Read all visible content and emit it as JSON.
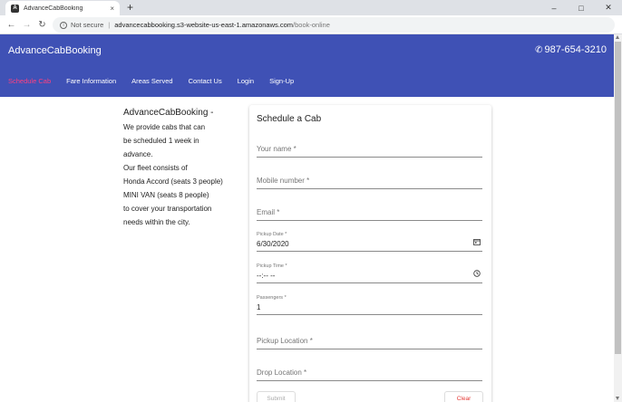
{
  "browser": {
    "tab_title": "AdvanceCabBooking",
    "tab_close": "×",
    "new_tab": "+",
    "security": "Not secure",
    "url_host": "advancecabbooking.s3-website-us-east-1.amazonaws.com",
    "url_path": "/book-online",
    "minimize": "–",
    "maximize": "□",
    "close": "✕"
  },
  "header": {
    "brand": "AdvanceCabBooking",
    "phone": "987-654-3210"
  },
  "nav": [
    {
      "label": "Schedule Cab",
      "active": true
    },
    {
      "label": "Fare Information"
    },
    {
      "label": "Areas Served"
    },
    {
      "label": "Contact Us"
    },
    {
      "label": "Login"
    },
    {
      "label": "Sign-Up"
    }
  ],
  "about": {
    "title": "AdvanceCabBooking -",
    "lines": [
      "We provide cabs that can",
      "be scheduled 1 week in",
      "advance.",
      "Our fleet consists of",
      "Honda Accord (seats 3 people)",
      "MINI VAN (seats 8 people)",
      "to cover your transportation",
      "needs within the city."
    ]
  },
  "form": {
    "title": "Schedule a Cab",
    "name_placeholder": "Your name *",
    "mobile_placeholder": "Mobile number *",
    "email_placeholder": "Email *",
    "pickup_date_label": "Pickup Date *",
    "pickup_date_value": "6/30/2020",
    "pickup_time_label": "Pickup Time *",
    "pickup_time_value": "--:-- --",
    "passengers_label": "Passengers *",
    "passengers_value": "1",
    "pickup_location_placeholder": "Pickup Location *",
    "drop_location_placeholder": "Drop Location *",
    "submit_label": "Submit",
    "clear_label": "Clear"
  },
  "colors": {
    "header_bg": "#3f51b5",
    "active_nav": "#ff4081",
    "clear_button": "#e53935"
  }
}
